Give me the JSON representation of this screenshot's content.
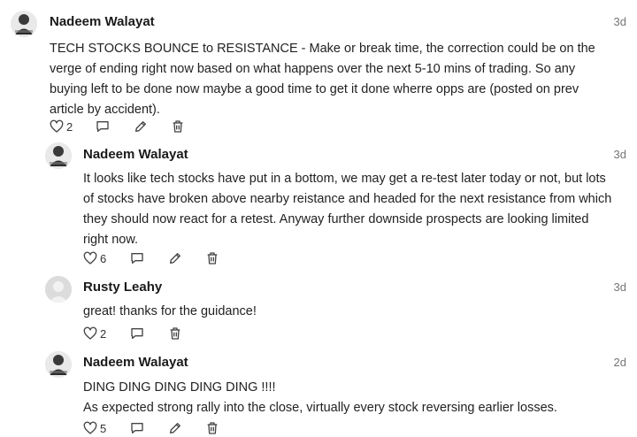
{
  "comments": [
    {
      "author": "Nadeem Walayat",
      "time": "3d",
      "avatar": "photo",
      "paragraphs": [
        "TECH STOCKS BOUNCE to RESISTANCE - Make or break time, the correction could be on the verge of ending right now based on what happens over the next 5-10 mins of trading. So any buying left to be done now maybe a good time to get it done wherre opps are (posted on prev article by accident)."
      ],
      "likes": "2"
    },
    {
      "author": "Nadeem Walayat",
      "time": "3d",
      "avatar": "photo",
      "paragraphs": [
        "It looks like tech stocks have put in a bottom, we may get a re-test later today or not,  but lots of stocks have broken above nearby reistance and headed for the next resistance from which they should now react for a retest. Anyway further downside prospects are looking limited right now."
      ],
      "likes": "6"
    },
    {
      "author": "Rusty Leahy",
      "time": "3d",
      "avatar": "placeholder",
      "paragraphs": [
        "great!  thanks for the guidance!"
      ],
      "likes": "2"
    },
    {
      "author": "Nadeem Walayat",
      "time": "2d",
      "avatar": "photo",
      "paragraphs": [
        "DING DING DING DING DING !!!!",
        "As expected strong rally into the close, virtually every stock reversing earlier losses."
      ],
      "likes": "5"
    }
  ],
  "icons": {
    "like": "heart-icon",
    "reply": "reply-icon",
    "edit": "pencil-icon",
    "delete": "trash-icon"
  }
}
